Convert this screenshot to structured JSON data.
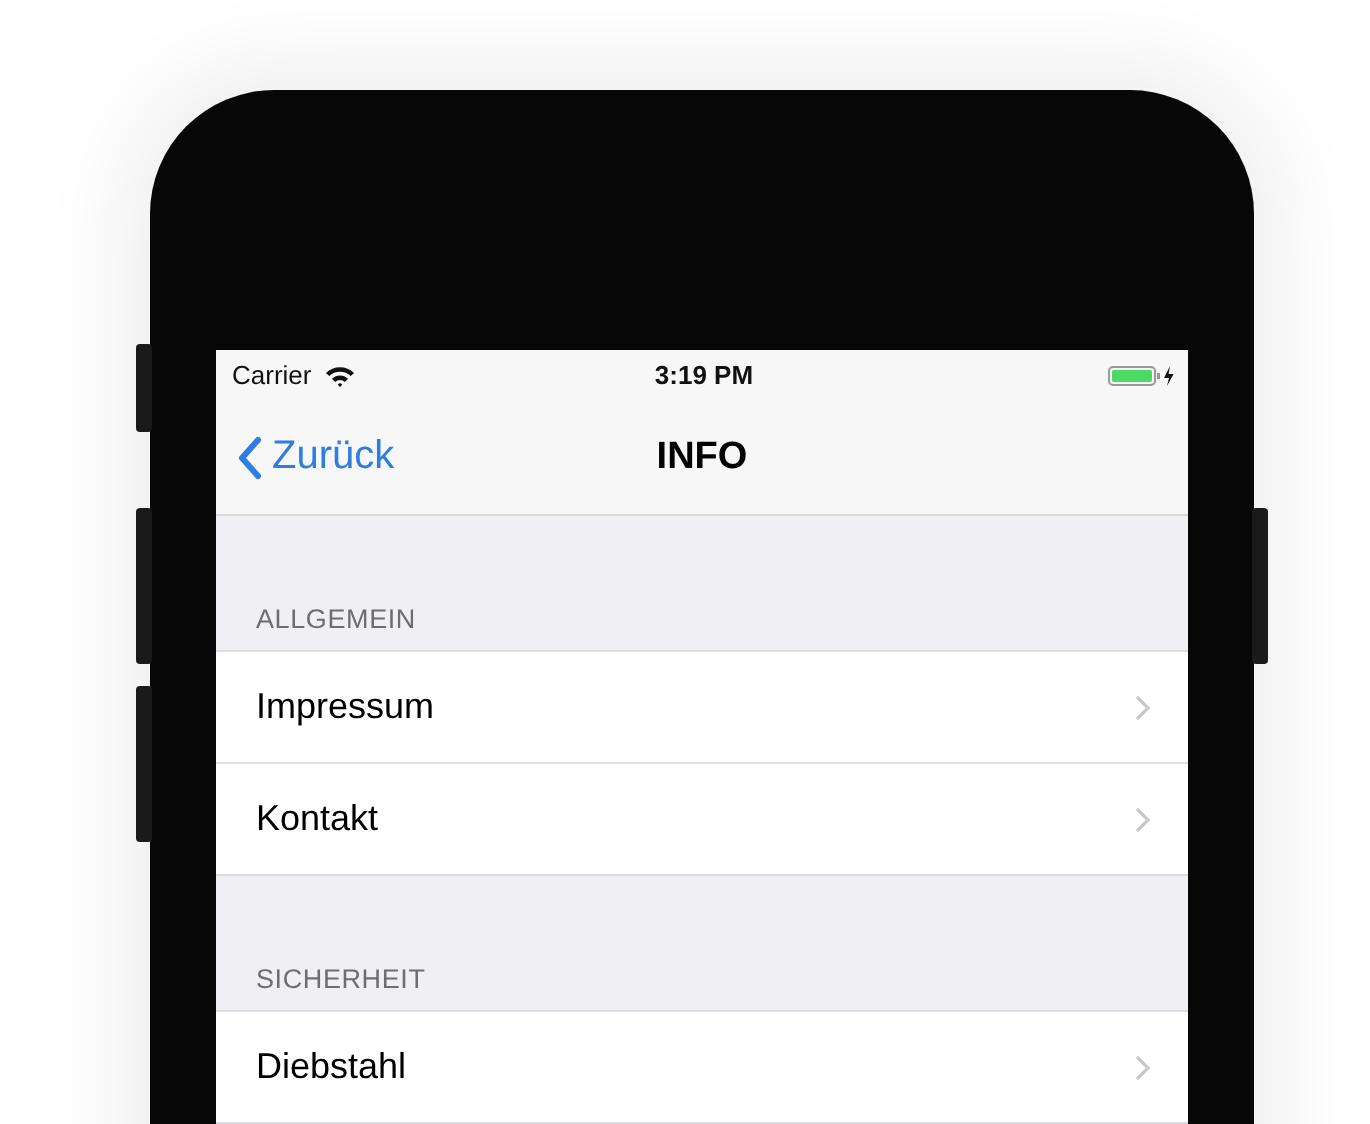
{
  "status_bar": {
    "carrier": "Carrier",
    "time": "3:19 PM"
  },
  "nav_bar": {
    "back_label": "Zurück",
    "title": "INFO"
  },
  "sections": [
    {
      "header": "ALLGEMEIN",
      "rows": [
        {
          "label": "Impressum"
        },
        {
          "label": "Kontakt"
        }
      ]
    },
    {
      "header": "SICHERHEIT",
      "rows": [
        {
          "label": "Diebstahl"
        }
      ]
    }
  ]
}
